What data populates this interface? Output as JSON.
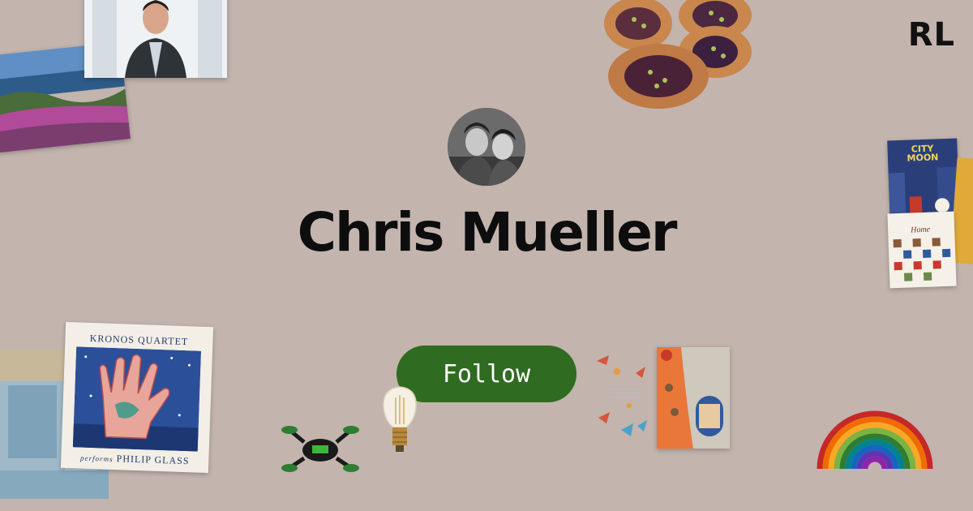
{
  "brand": {
    "logo_text": "RL"
  },
  "profile": {
    "name": "Chris Mueller"
  },
  "actions": {
    "follow_label": "Follow"
  },
  "decor": {
    "album": {
      "title": "KRONOS QUARTET",
      "performs": "performs",
      "artist": "PHILIP GLASS"
    },
    "book_city_moon": {
      "title_line1": "CITY",
      "title_line2": "MOON"
    },
    "book_home": {
      "title": "Home"
    }
  },
  "colors": {
    "background": "#c3b4ae",
    "follow_button": "#2f6b20",
    "text": "#0d0d0d"
  },
  "icons": [
    "avatar-photo",
    "landscape-photo",
    "portrait-photo",
    "pastry-photo",
    "drone-toy",
    "light-bulb",
    "rainbow-toy",
    "bird-illustration"
  ]
}
